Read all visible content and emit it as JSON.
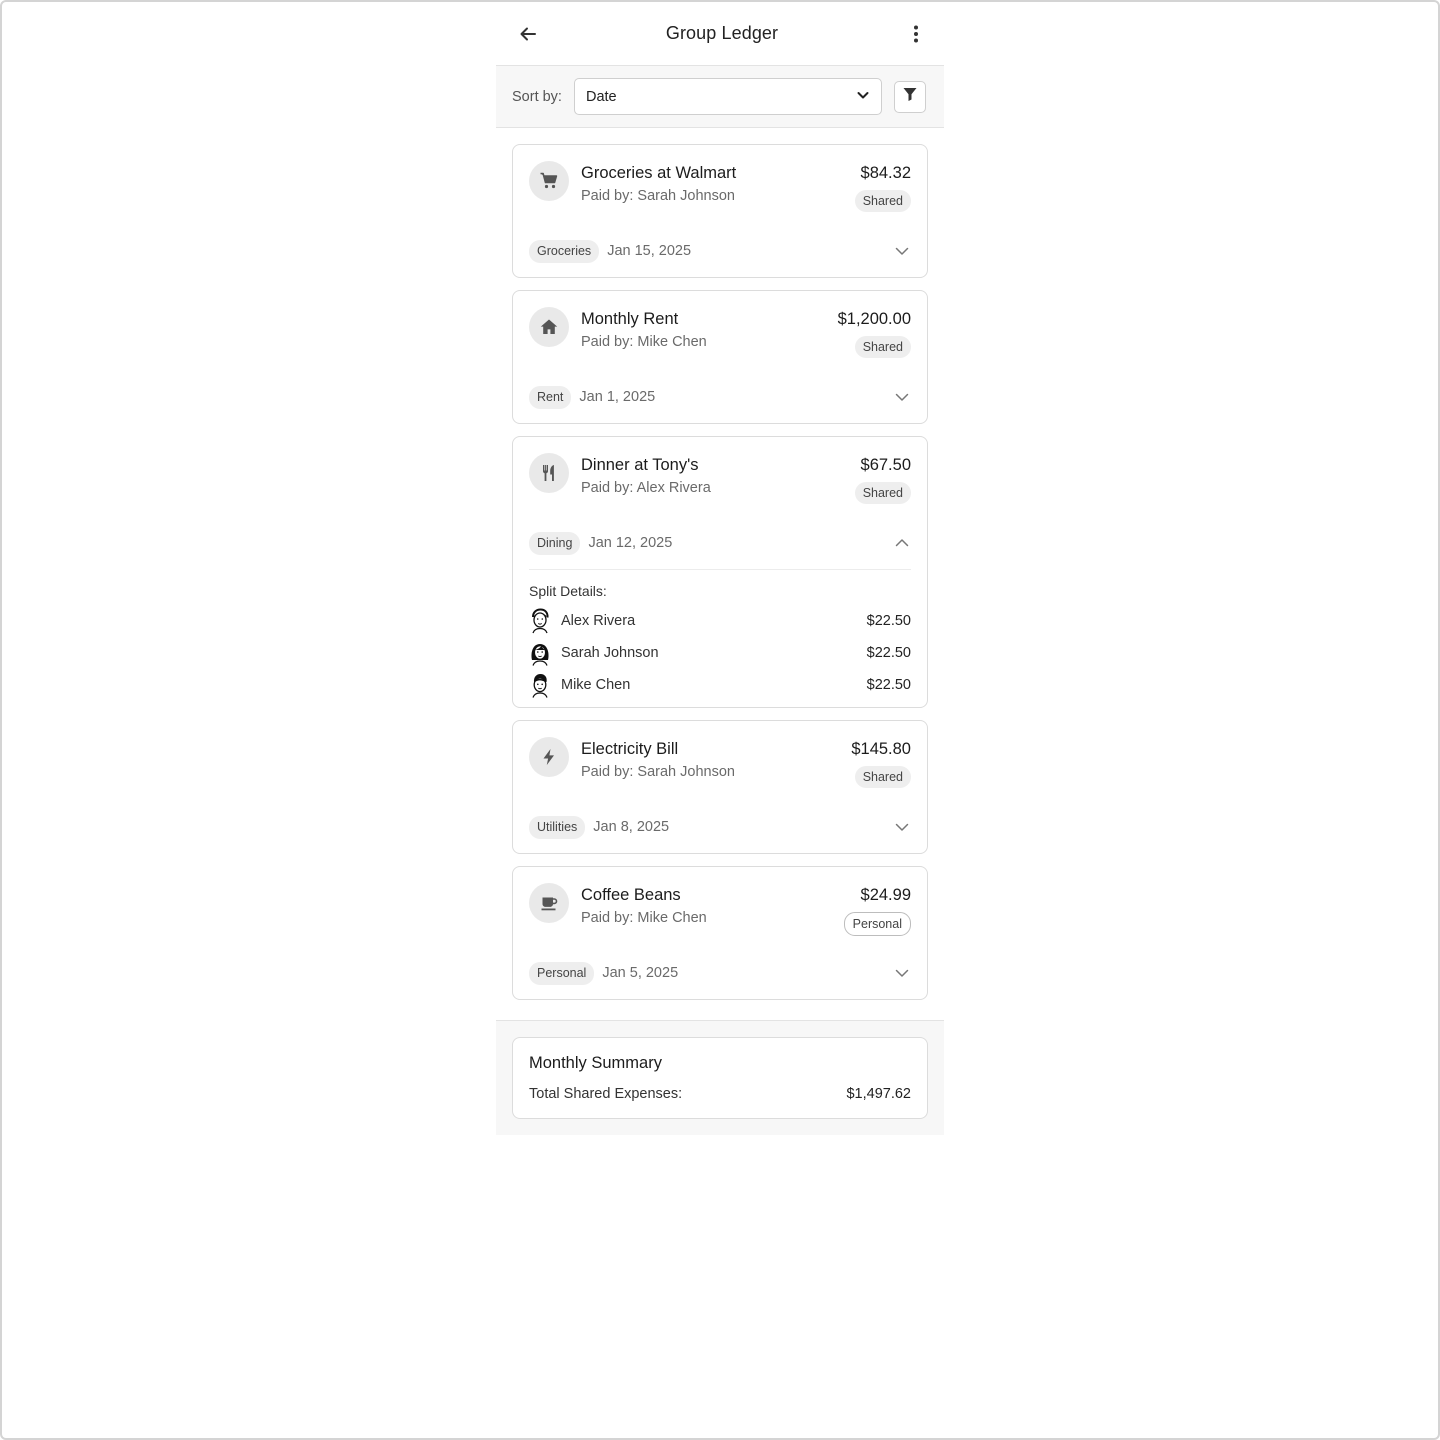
{
  "header": {
    "title": "Group Ledger",
    "back_icon": "arrow-left-icon",
    "menu_icon": "more-vertical-icon"
  },
  "sort": {
    "label": "Sort by:",
    "selected": "Date"
  },
  "expenses": [
    {
      "name": "Groceries at Walmart",
      "paid_by": "Paid by: Sarah Johnson",
      "amount": "$84.32",
      "badge": "Shared",
      "tag": "Groceries",
      "date": "Jan 15, 2025",
      "icon": "shopping-cart-icon"
    },
    {
      "name": "Monthly Rent",
      "paid_by": "Paid by: Mike Chen",
      "amount": "$1,200.00",
      "badge": "Shared",
      "tag": "Rent",
      "date": "Jan 1, 2025",
      "icon": "home-icon"
    },
    {
      "name": "Dinner at Tony's",
      "paid_by": "Paid by: Alex Rivera",
      "amount": "$67.50",
      "badge": "Shared",
      "tag": "Dining",
      "date": "Jan 12, 2025",
      "icon": "utensils-icon",
      "split_title": "Split Details:",
      "split": [
        {
          "name": "Alex Rivera",
          "amount": "$22.50"
        },
        {
          "name": "Sarah Johnson",
          "amount": "$22.50"
        },
        {
          "name": "Mike Chen",
          "amount": "$22.50"
        }
      ]
    },
    {
      "name": "Electricity Bill",
      "paid_by": "Paid by: Sarah Johnson",
      "amount": "$145.80",
      "badge": "Shared",
      "tag": "Utilities",
      "date": "Jan 8, 2025",
      "icon": "lightning-icon"
    },
    {
      "name": "Coffee Beans",
      "paid_by": "Paid by: Mike Chen",
      "amount": "$24.99",
      "badge": "Personal",
      "tag": "Personal",
      "date": "Jan 5, 2025",
      "icon": "coffee-cup-icon"
    }
  ],
  "summary": {
    "title": "Monthly Summary",
    "label": "Total Shared Expenses:",
    "value": "$1,497.62"
  }
}
